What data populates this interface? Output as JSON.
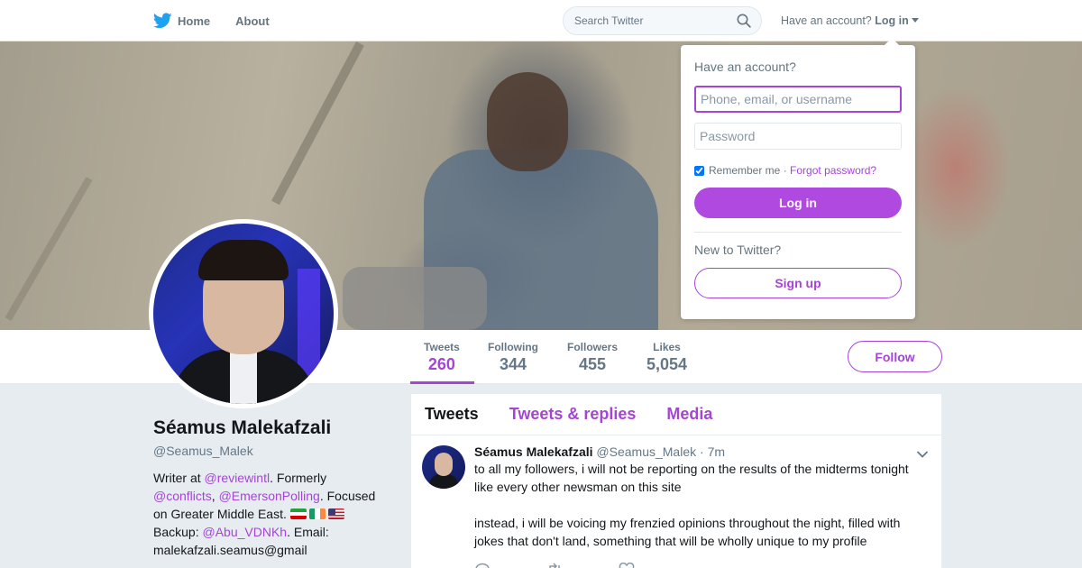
{
  "colors": {
    "accent": "#a445d6",
    "login_button": "#b049e0",
    "twitter_blue": "#1da1f2",
    "background": "#e6ecf0"
  },
  "nav": {
    "home_label": "Home",
    "about_label": "About",
    "search_placeholder": "Search Twitter",
    "account_prompt": "Have an account?",
    "login_label": "Log in",
    "icons": {
      "home": "twitter-bird-icon",
      "search": "magnifier-icon",
      "dropdown": "caret-down-icon"
    }
  },
  "login_dropdown": {
    "title": "Have an account?",
    "username_placeholder": "Phone, email, or username",
    "password_placeholder": "Password",
    "remember_label": "Remember me",
    "separator": "·",
    "forgot_label": "Forgot password?",
    "remember_checked": true,
    "login_button": "Log in",
    "new_prompt": "New to Twitter?",
    "signup_button": "Sign up"
  },
  "profile": {
    "name": "Séamus Malekafzali",
    "handle": "@Seamus_Malek",
    "bio": {
      "part1": "Writer at ",
      "link1": "@reviewintl",
      "part2": ". Formerly ",
      "link2": "@conflicts",
      "part3": ", ",
      "link3": "@EmersonPolling",
      "part4": ". Focused on Greater Middle East. ",
      "flags": [
        "flag-iran",
        "flag-ireland",
        "flag-usa"
      ],
      "part5": "Backup: ",
      "link4": "@Abu_VDNKh",
      "part6": ". Email: malekafzali.seamus@gmail"
    },
    "follow_button": "Follow"
  },
  "stats": [
    {
      "label": "Tweets",
      "value": "260",
      "active": true
    },
    {
      "label": "Following",
      "value": "344",
      "active": false
    },
    {
      "label": "Followers",
      "value": "455",
      "active": false
    },
    {
      "label": "Likes",
      "value": "5,054",
      "active": false
    }
  ],
  "timeline": {
    "tabs": [
      {
        "label": "Tweets",
        "active": true
      },
      {
        "label": "Tweets & replies",
        "active": false
      },
      {
        "label": "Media",
        "active": false
      }
    ],
    "tweet": {
      "name": "Séamus Malekafzali",
      "handle": "@Seamus_Malek",
      "separator": "·",
      "time": "7m",
      "text": "to all my followers, i will not be reporting on the results of the midterms tonight like every other newsman on this site\n\ninstead, i will be voicing my frenzied opinions throughout the night, filled with jokes that don't land, something that will be wholly unique to my profile",
      "actions": [
        "reply-icon",
        "retweet-icon",
        "like-icon"
      ]
    }
  }
}
